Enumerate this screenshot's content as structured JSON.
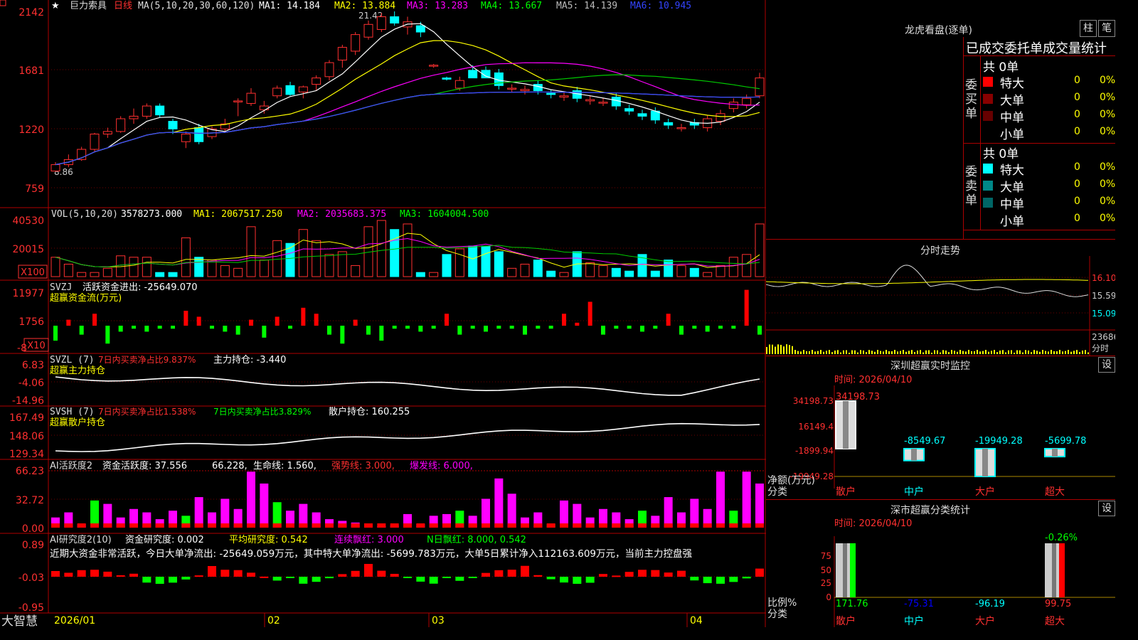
{
  "header": {
    "stock_name": "巨力索具",
    "period": "日线",
    "ma_label": "MA(5,10,20,30,60,120)",
    "ma1": "MA1: 14.184",
    "ma2": "MA2: 13.884",
    "ma3": "MA3: 13.283",
    "ma4": "MA4: 13.667",
    "ma5": "MA5: 14.139",
    "ma6": "MA6: 10.945",
    "star": "★"
  },
  "price_axis": {
    "ticks": [
      "2142",
      "1681",
      "1220",
      "759"
    ],
    "high_label": "21.42",
    "low_label": "8.86"
  },
  "vol": {
    "label": "VOL(5,10,20)",
    "value": "3578273.000",
    "ma1": "MA1: 2067517.250",
    "ma2": "MA2: 2035683.375",
    "ma3": "MA3: 1604004.500",
    "ticks": [
      "40530",
      "20015"
    ],
    "unit": "X100"
  },
  "svzj": {
    "label": "SVZJ",
    "title": "活跃资金进出: -25649.070",
    "subtitle": "超赢资金流(万元)",
    "ticks": [
      "11977",
      "1756",
      "-8"
    ],
    "unit": "X10"
  },
  "svzl": {
    "label": "SVZL (7)",
    "text1": "7日内买卖净占比9.837%",
    "text2": "主力持仓: -3.440",
    "subtitle": "超赢主力持仓",
    "ticks": [
      "6.83",
      "-4.06",
      "-14.96"
    ]
  },
  "svsh": {
    "label": "SVSH (7)",
    "text1": "7日内买卖净占比1.538%",
    "text2": "7日内买卖净占比3.829%",
    "text3": "散户持仓: 160.255",
    "subtitle": "超赢散户持仓",
    "ticks": [
      "167.49",
      "148.06",
      "129.34"
    ]
  },
  "ai_active": {
    "label": "AI活跃度2",
    "text1": "资金活跃度: 37.556",
    "text2": "66.228,",
    "text3": "生命线: 1.560,",
    "text4": "强势线: 3.000,",
    "text5": "爆发线: 6.000,",
    "ticks": [
      "66.23",
      "32.72",
      "0.00"
    ]
  },
  "ai_research": {
    "label": "AI研究度2(10)",
    "text1": "资金研究度: 0.002",
    "text2": "平均研究度: 0.542",
    "text3": "连续飘红: 3.000",
    "text4": "N日飘红: 8.000, 0.542",
    "comment": "近期大资金非常活跃，今日大单净流出: -25649.059万元，其中特大单净流出: -5699.783万元，大单5日累计净入112163.609万元，当前主力控盘强",
    "ticks": [
      "0.89",
      "-0.03",
      "-0.95"
    ]
  },
  "date_axis": [
    "2026/01",
    "02",
    "03",
    "04"
  ],
  "brand": "大智慧",
  "right_panel": {
    "longhu_title": "龙虎看盘(逐单)",
    "btn_zhu": "柱",
    "btn_bi": "笔",
    "table_header": "已成交委托单成交量统计",
    "buy": {
      "side_label": "委买单",
      "total": "共 0单",
      "rows": [
        {
          "label": "特大",
          "count": "0",
          "pct": "0%",
          "color": "#ff0000"
        },
        {
          "label": "大单",
          "count": "0",
          "pct": "0%",
          "color": "#880000"
        },
        {
          "label": "中单",
          "count": "0",
          "pct": "0%",
          "color": "#660000"
        },
        {
          "label": "小单",
          "count": "0",
          "pct": "0%",
          "color": ""
        }
      ]
    },
    "sell": {
      "side_label": "委卖单",
      "total": "共 0单",
      "rows": [
        {
          "label": "特大",
          "count": "0",
          "pct": "0%",
          "color": "#00ffff"
        },
        {
          "label": "大单",
          "count": "0",
          "pct": "0%",
          "color": "#008888"
        },
        {
          "label": "中单",
          "count": "0",
          "pct": "0%",
          "color": "#006666"
        },
        {
          "label": "小单",
          "count": "0",
          "pct": "0%",
          "color": ""
        }
      ]
    },
    "intraday_title": "分时走势",
    "intraday_ticks": [
      "16.10",
      "15.59",
      "15.09",
      "23686",
      "分时"
    ],
    "monitor": {
      "title": "深圳超赢实时监控",
      "btn": "设",
      "time": "时间: 2026/04/10",
      "ticks": [
        "34198.73",
        "16149.4",
        "-1899.94",
        "-19949.28"
      ],
      "ylabel": "净额(万元)",
      "xlabel": "分类",
      "categories": [
        "散户",
        "中户",
        "大户",
        "超大"
      ],
      "values": [
        34198.73,
        -8549.67,
        -19949.28,
        -5699.78
      ],
      "labels": [
        "34198.73",
        "-8549.67",
        "-19949.28",
        "-5699.78"
      ]
    },
    "classify": {
      "title": "深市超赢分类统计",
      "btn": "设",
      "time": "时间: 2026/04/10",
      "ticks": [
        "75",
        "50",
        "25",
        "0"
      ],
      "ylabel": "比例%",
      "xlabel": "分类",
      "top_label": "-0.26%",
      "categories": [
        "散户",
        "中户",
        "大户",
        "超大"
      ],
      "values": [
        171.76,
        -75.31,
        -96.19,
        99.75
      ],
      "labels": [
        "171.76",
        "-75.31",
        "-96.19",
        "99.75"
      ]
    }
  },
  "chart_data": {
    "type": "candlestick",
    "n_bars": 55,
    "ylim": [
      7.59,
      21.42
    ],
    "price_ticks": [
      21.42,
      16.81,
      12.2,
      7.59
    ],
    "x_dates": [
      "2026/01",
      "02",
      "03",
      "04"
    ],
    "ohlc": [
      [
        8.9,
        9.6,
        8.86,
        9.4
      ],
      [
        9.4,
        10.2,
        9.2,
        9.8
      ],
      [
        9.8,
        10.8,
        9.7,
        10.6
      ],
      [
        10.6,
        11.9,
        10.4,
        11.8
      ],
      [
        11.8,
        12.3,
        11.5,
        12.0
      ],
      [
        12.0,
        13.2,
        11.9,
        13.0
      ],
      [
        13.0,
        13.8,
        12.6,
        13.2
      ],
      [
        13.2,
        14.2,
        13.0,
        14.0
      ],
      [
        14.0,
        14.2,
        13.1,
        13.3
      ],
      [
        12.8,
        13.0,
        11.8,
        12.2
      ],
      [
        11.2,
        12.0,
        10.7,
        11.8
      ],
      [
        12.3,
        12.6,
        11.0,
        11.2
      ],
      [
        11.6,
        12.4,
        11.4,
        12.2
      ],
      [
        12.2,
        13.0,
        12.0,
        12.6
      ],
      [
        14.4,
        14.6,
        13.2,
        14.4
      ],
      [
        14.2,
        15.4,
        14.0,
        15.0
      ],
      [
        13.7,
        14.4,
        13.4,
        14.0
      ],
      [
        14.8,
        15.6,
        14.6,
        15.4
      ],
      [
        15.6,
        15.9,
        14.8,
        14.9
      ],
      [
        15.1,
        15.6,
        14.6,
        15.5
      ],
      [
        15.7,
        16.4,
        15.2,
        16.2
      ],
      [
        16.3,
        17.6,
        16.0,
        17.4
      ],
      [
        17.6,
        18.8,
        17.0,
        18.6
      ],
      [
        18.3,
        19.8,
        18.0,
        19.6
      ],
      [
        19.4,
        20.7,
        19.2,
        20.4
      ],
      [
        20.0,
        21.3,
        19.8,
        21.0
      ],
      [
        21.0,
        21.42,
        20.3,
        20.5
      ],
      [
        20.2,
        21.0,
        19.6,
        20.6
      ],
      [
        20.3,
        20.6,
        19.4,
        19.8
      ],
      [
        17.2,
        17.3,
        17.0,
        17.2
      ],
      [
        16.2,
        16.3,
        16.0,
        16.1
      ],
      [
        15.4,
        16.3,
        15.2,
        16.0
      ],
      [
        16.8,
        17.2,
        16.2,
        16.2
      ],
      [
        16.8,
        17.1,
        16.2,
        16.2
      ]
    ],
    "volume": [
      14000,
      9000,
      3000,
      3000,
      6000,
      15000,
      14000,
      14000,
      3000,
      3000,
      28000,
      14000,
      12000,
      8000,
      6000,
      36000,
      12000,
      26000,
      24000,
      34000,
      26000,
      16000,
      18000,
      8000,
      36000,
      40530,
      34000,
      38000,
      3000,
      3000,
      16000,
      20000,
      22000,
      22000
    ],
    "svzj": [
      -5,
      2,
      -3,
      4,
      -6,
      -2,
      -1,
      -2,
      -1,
      -1,
      5,
      3,
      -1,
      -2,
      -3,
      2,
      -4,
      3,
      -1,
      6,
      4,
      -3,
      -6,
      2,
      -3,
      -5
    ],
    "ai_active": [
      12,
      18,
      4,
      32,
      28,
      12,
      22,
      18,
      10,
      20,
      14,
      36,
      18,
      34,
      22,
      66,
      52,
      30,
      20,
      28,
      18,
      10,
      8,
      6,
      4,
      2,
      3,
      16,
      4,
      14,
      16,
      20,
      14,
      34,
      58,
      40
    ]
  }
}
